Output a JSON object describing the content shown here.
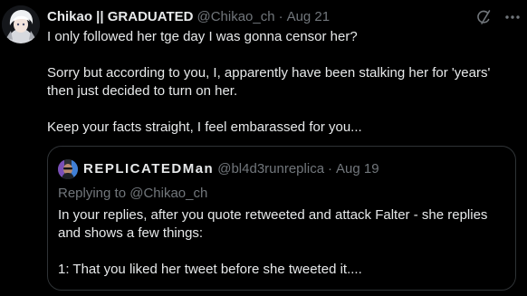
{
  "tweet": {
    "author_name": "Chikao || GRADUATED",
    "handle": "@Chikao_ch",
    "separator": "·",
    "date": "Aug 21",
    "lines": [
      "I only followed her tge day I was gonna censor her?",
      "Sorry but according to you, I, apparently have been stalking her for 'years'",
      "then just decided to turn on her.",
      "Keep your facts straight, I feel embarassed for you..."
    ]
  },
  "quote": {
    "author_name": "REPLICATEDMan",
    "handle": "@bl4d3runreplica",
    "separator": "·",
    "date": "Aug 19",
    "replying_to": "Replying to @Chikao_ch",
    "lines": [
      "In your replies, after you quote retweeted and attack Falter - she replies",
      "and shows a few things:",
      "1: That you liked her tweet before she tweeted it...."
    ]
  },
  "colors": {
    "background": "#000000",
    "text_primary": "#e7e9ea",
    "text_secondary": "#71767b",
    "border": "#2f3336"
  },
  "icons": [
    "grok-icon",
    "more-icon"
  ]
}
